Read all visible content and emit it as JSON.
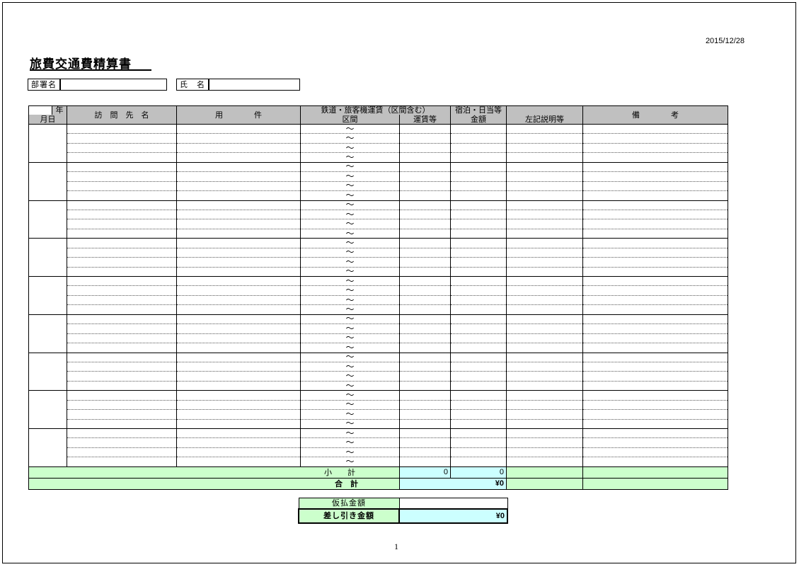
{
  "header": {
    "date": "2015/12/28",
    "title": "旅費交通費精算書",
    "dept_label": "部署名",
    "dept_value": "",
    "name_label": "氏　名",
    "name_value": ""
  },
  "table_header": {
    "year": "年",
    "month_day": "月日",
    "destination": "訪　問　先　名",
    "purpose": "用　　　　件",
    "rail_group": "鉄道・旅客機運賃（区間含む）",
    "section": "区間",
    "fare": "運賃等",
    "lodging_group": "宿泊・日当等",
    "amount": "金額",
    "explanation": "左記説明等",
    "remarks": "備　　　　考"
  },
  "section_mark": "～",
  "entry_groups": 9,
  "rows_per_group": 4,
  "subtotal": {
    "label": "小　　計",
    "fare": "0",
    "lodging": "0"
  },
  "total": {
    "label": "合　計",
    "value": "¥0"
  },
  "settlement": {
    "advance_label": "仮払金額",
    "advance_value": "",
    "diff_label": "差し引き金額",
    "diff_value": "¥0"
  },
  "page_number": "1",
  "colors": {
    "header_gray": "#c0c0c0",
    "green": "#ccffcc",
    "blue": "#ccffff"
  }
}
